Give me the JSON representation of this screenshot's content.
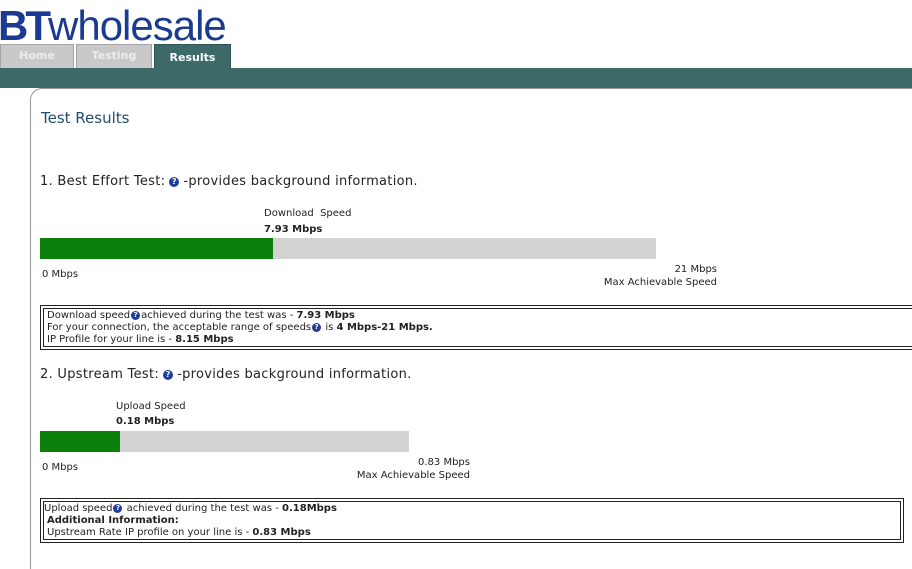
{
  "brand": {
    "bt": "BT",
    "word": "wholesale",
    "color": "#1a3b8f"
  },
  "tabs": [
    {
      "label": "Home",
      "active": false
    },
    {
      "label": "Testing",
      "active": false
    },
    {
      "label": "Results",
      "active": true
    }
  ],
  "page_title": "Test Results",
  "sections": {
    "best_effort": {
      "heading_prefix": "1. Best Effort Test:",
      "heading_suffix": "-provides background information.",
      "bar_label": "Download  Speed",
      "bar_value": "7.93 Mbps",
      "fill_fraction": 0.3776,
      "scale_min": "0 Mbps",
      "scale_max": "21 Mbps",
      "scale_max_label": "Max Achievable Speed",
      "info": {
        "line1_prefix": "Download speed",
        "line1_mid": "achieved during the test was - ",
        "line1_value": "7.93 Mbps",
        "line2_prefix": "For your connection, the acceptable range of speeds",
        "line2_mid": " is ",
        "line2_value": "4 Mbps-21 Mbps.",
        "line3_prefix": "IP Profile for your line is - ",
        "line3_value": "8.15 Mbps"
      }
    },
    "upstream": {
      "heading_prefix": "2. Upstream Test:",
      "heading_suffix": "-provides background information.",
      "bar_label": "Upload Speed",
      "bar_value": "0.18 Mbps",
      "fill_fraction": 0.2169,
      "scale_min": "0 Mbps",
      "scale_max": "0.83 Mbps",
      "scale_max_label": "Max Achievable Speed",
      "info": {
        "line1_prefix": "Upload speed",
        "line1_mid": " achieved during the test was - ",
        "line1_value": "0.18Mbps",
        "line2": "Additional Information:",
        "line3_prefix": "Upstream Rate IP profile on your line is - ",
        "line3_value": "0.83 Mbps"
      }
    }
  },
  "colors": {
    "accent": "#3d6a69",
    "bar_fill": "#0a7f0a",
    "bar_track": "#d3d3d3",
    "help_icon": "#1f3d9a"
  },
  "icons": {
    "help": "help-icon"
  }
}
